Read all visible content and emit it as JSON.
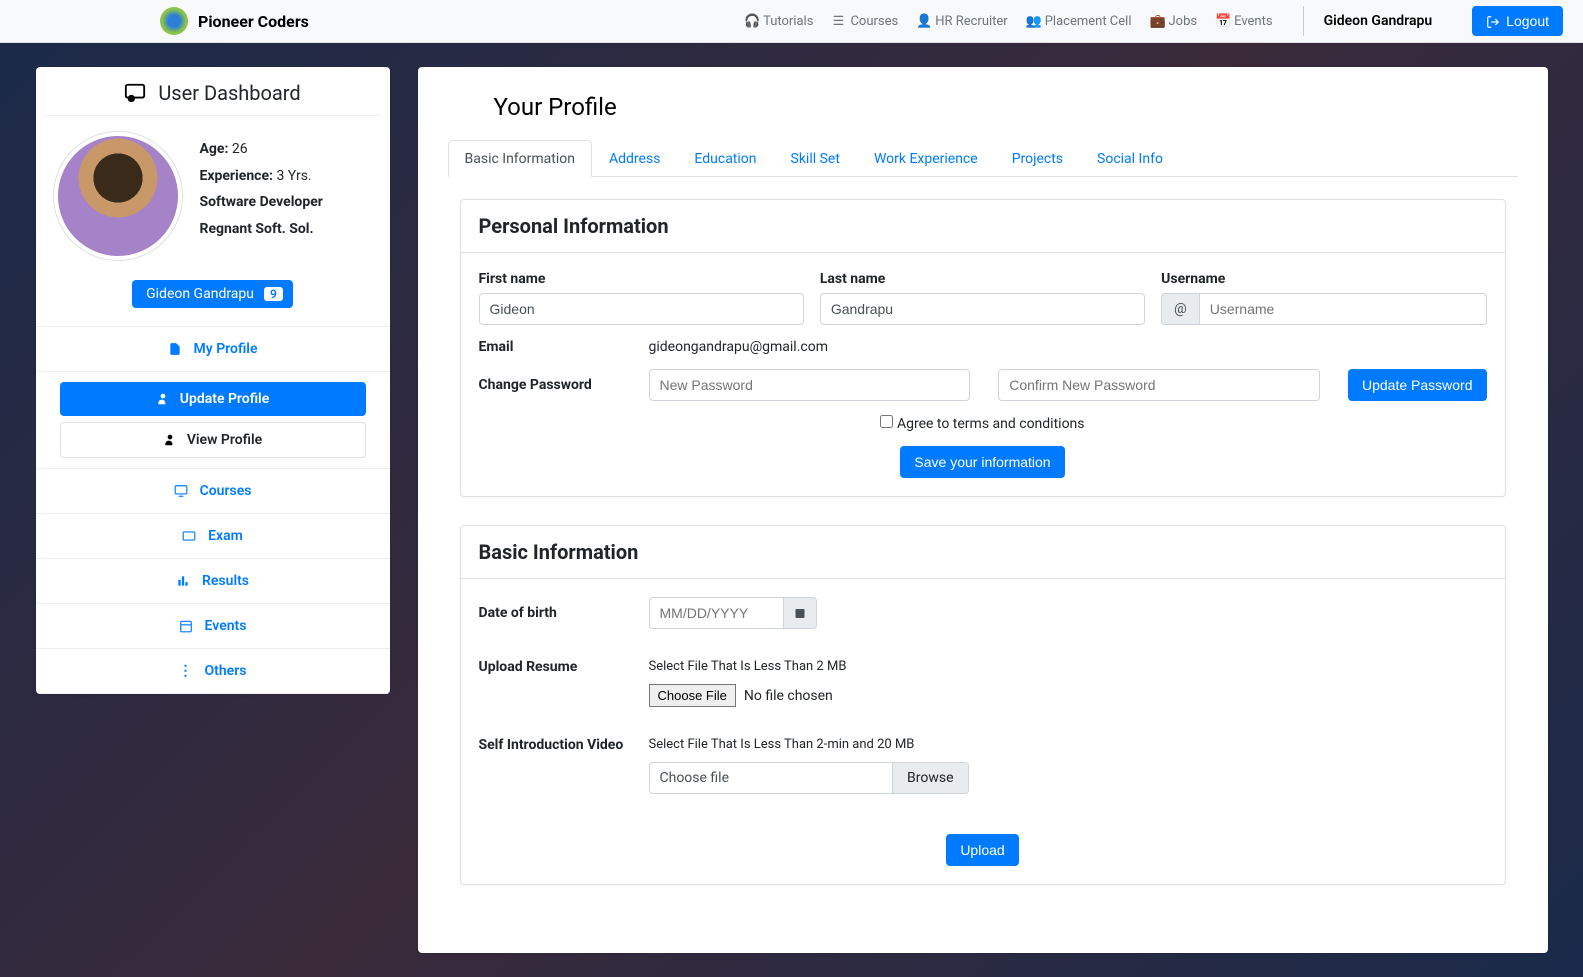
{
  "brand": "Pioneer Coders",
  "topnav": [
    {
      "label": "Tutorials",
      "icon": "headset"
    },
    {
      "label": "Courses",
      "icon": "list"
    },
    {
      "label": "HR Recruiter",
      "icon": "user"
    },
    {
      "label": "Placement Cell",
      "icon": "users"
    },
    {
      "label": "Jobs",
      "icon": "briefcase"
    },
    {
      "label": "Events",
      "icon": "calendar"
    }
  ],
  "current_user": "Gideon Gandrapu",
  "logout_label": "Logout",
  "sidebar": {
    "heading": "User Dashboard",
    "age_label": "Age:",
    "age_value": "26",
    "exp_label": "Experience:",
    "exp_value": "3 Yrs.",
    "role": "Software Developer",
    "company": "Regnant Soft. Sol.",
    "name_badge": "Gideon Gandrapu",
    "badge_count": "9",
    "items": {
      "my_profile": "My Profile",
      "update_profile": "Update Profile",
      "view_profile": "View Profile",
      "courses": "Courses",
      "exam": "Exam",
      "results": "Results",
      "events": "Events",
      "others": "Others"
    }
  },
  "page_title": "Your Profile",
  "tabs": [
    {
      "label": "Basic Information",
      "active": true
    },
    {
      "label": "Address"
    },
    {
      "label": "Education"
    },
    {
      "label": "Skill Set"
    },
    {
      "label": "Work Experience"
    },
    {
      "label": "Projects"
    },
    {
      "label": "Social Info"
    }
  ],
  "personal": {
    "heading": "Personal Information",
    "first_name_label": "First name",
    "first_name_value": "Gideon",
    "last_name_label": "Last name",
    "last_name_value": "Gandrapu",
    "username_label": "Username",
    "username_placeholder": "Username",
    "username_prefix": "@",
    "email_label": "Email",
    "email_value": "gideongandrapu@gmail.com",
    "change_pwd_label": "Change Password",
    "new_pwd_placeholder": "New Password",
    "confirm_pwd_placeholder": "Confirm New Password",
    "update_pwd_btn": "Update Password",
    "terms_label": "Agree to terms and conditions",
    "save_btn": "Save your information"
  },
  "basic": {
    "heading": "Basic Information",
    "dob_label": "Date of birth",
    "dob_placeholder": "MM/DD/YYYY",
    "resume_label": "Upload Resume",
    "resume_hint": "Select File That Is Less Than 2 MB",
    "choose_file_btn": "Choose File",
    "no_file_text": "No file chosen",
    "video_label": "Self Introduction Video",
    "video_hint": "Select File That Is Less Than 2-min and 20 MB",
    "choose_file_label": "Choose file",
    "browse_label": "Browse",
    "upload_btn": "Upload"
  }
}
